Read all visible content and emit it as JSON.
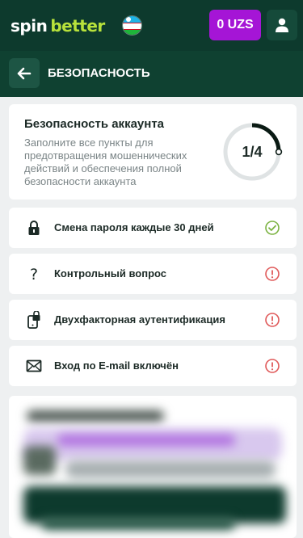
{
  "header": {
    "logo_part1": "spin",
    "logo_part2": "better",
    "balance": "0 UZS"
  },
  "subheader": {
    "title": "БЕЗОПАСНОСТЬ"
  },
  "summary": {
    "title": "Безопасность аккаунта",
    "description": "Заполните все пункты для предотвращения мошеннических действий и обеспечения полной безопасности аккаунта",
    "progress_text": "1/4",
    "progress_fraction": 0.25
  },
  "security_items": [
    {
      "label": "Смена пароля каждые 30 дней",
      "icon": "lock-icon",
      "status": "done"
    },
    {
      "label": "Контрольный вопрос",
      "icon": "question-icon",
      "status": "warning"
    },
    {
      "label": "Двухфакторная аутентификация",
      "icon": "phone-lock-icon",
      "status": "warning"
    },
    {
      "label": "Вход по E-mail включён",
      "icon": "envelope-icon",
      "status": "warning"
    }
  ],
  "colors": {
    "header_bg": "#0d3a2d",
    "subheader_bg": "#0f4131",
    "balance_bg": "#a515d6",
    "brand_green": "#b8e23b",
    "ok_green": "#7cb342",
    "warn_red": "#e05a5a"
  }
}
